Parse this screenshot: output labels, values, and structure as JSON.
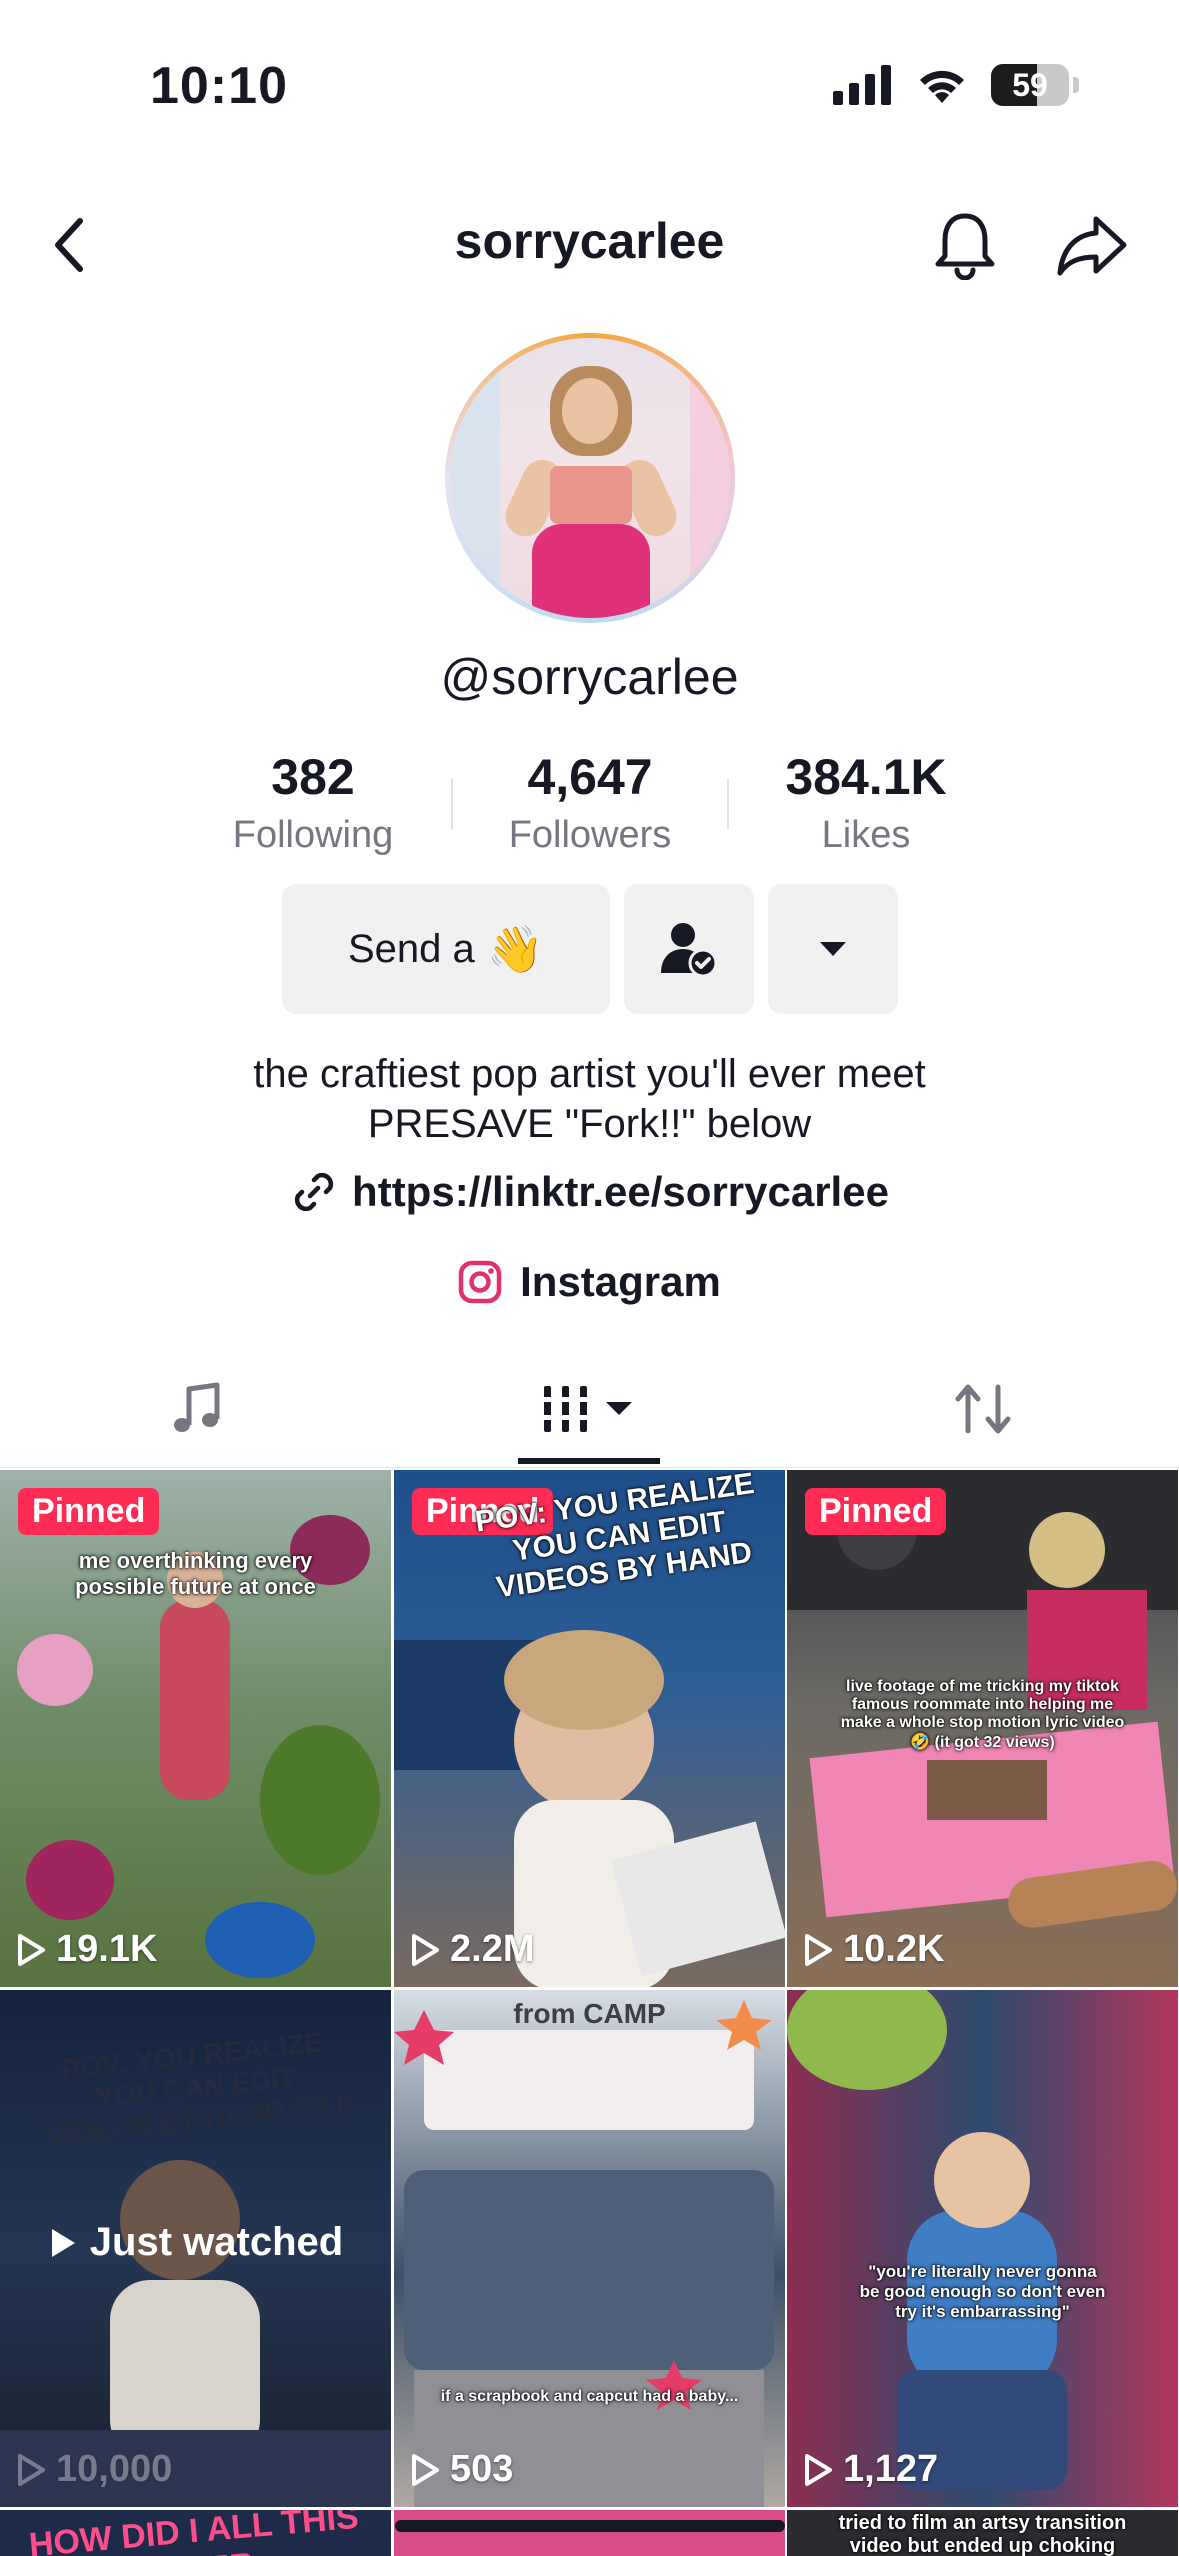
{
  "status_bar": {
    "time": "10:10",
    "battery": "59",
    "battery_level": 0.59
  },
  "header": {
    "title": "sorrycarlee"
  },
  "profile": {
    "username": "@sorrycarlee",
    "stats": [
      {
        "value": "382",
        "label": "Following"
      },
      {
        "value": "4,647",
        "label": "Followers"
      },
      {
        "value": "384.1K",
        "label": "Likes"
      }
    ],
    "send_button_label": "Send a",
    "send_button_emoji": "👋",
    "bio_line1": "the craftiest pop artist you'll ever meet",
    "bio_line2": "PRESAVE \"Fork!!\" below",
    "link": "https://linktr.ee/sorrycarlee",
    "instagram_label": "Instagram"
  },
  "colors": {
    "accent": "#fe2c55",
    "text": "#161823",
    "muted": "#75767f",
    "button_bg": "#f1f1f2"
  },
  "tabs": [
    {
      "name": "music",
      "icon": "music-note-icon"
    },
    {
      "name": "videos",
      "icon": "grid-icon",
      "selected": true
    },
    {
      "name": "reposts",
      "icon": "repost-icon"
    }
  ],
  "videos": [
    {
      "pinned_label": "Pinned",
      "views": "19.1K",
      "caption": "me overthinking every possible future at once"
    },
    {
      "pinned_label": "Pinned",
      "views": "2.2M",
      "caption": "POV: YOU REALIZE YOU CAN EDIT VIDEOS BY HAND"
    },
    {
      "pinned_label": "Pinned",
      "views": "10.2K",
      "caption": "live footage of me tricking my tiktok famous roommate into helping me make a whole stop motion lyric video 🤣 (it got 32 views)"
    },
    {
      "views": "10,000",
      "just_watched": "Just watched",
      "caption": "POV: YOU REALIZE YOU CAN EDIT VIDEOS BY HAND PT 6"
    },
    {
      "views": "503",
      "title_text": "from CAMP",
      "caption": "if a scrapbook and capcut had a baby..."
    },
    {
      "views": "1,127",
      "caption": "\"you're literally never gonna be good enough so don't even try it's embarrassing\""
    },
    {
      "caption": "HOW DID I ALL THIS PAPER"
    },
    {
      "caption": ""
    },
    {
      "caption": "tried to film an artsy transition video but ended up choking on a"
    }
  ]
}
